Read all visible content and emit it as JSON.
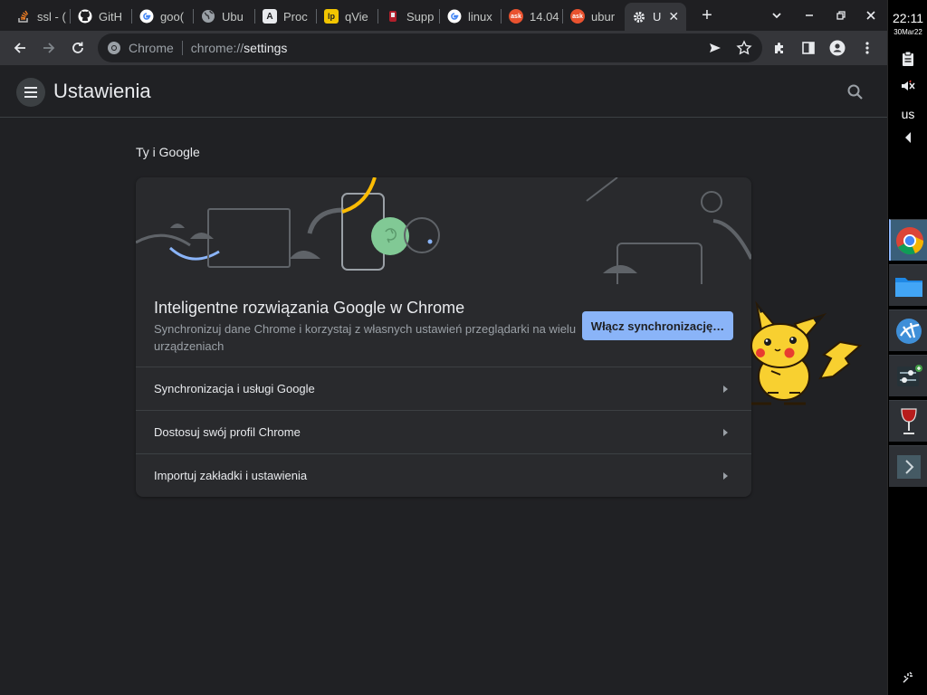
{
  "tabs": [
    {
      "title": "ssl - (",
      "icon": "stackoverflow-icon",
      "color": "#f48024"
    },
    {
      "title": "GitH",
      "icon": "github-icon",
      "color": "#ffffff"
    },
    {
      "title": "goo(",
      "icon": "google-icon",
      "color": "#ffffff"
    },
    {
      "title": "Ubu",
      "icon": "globe-icon",
      "color": "#c4c7c5"
    },
    {
      "title": "Proc",
      "icon": "letter-a-icon",
      "color": "#e8eaed"
    },
    {
      "title": "qVie",
      "icon": "lp-icon",
      "color": "#f2c500"
    },
    {
      "title": "Supp",
      "icon": "document-icon",
      "color": "#b11f2b"
    },
    {
      "title": "linux",
      "icon": "google-icon",
      "color": "#ffffff"
    },
    {
      "title": "14.04",
      "icon": "askubuntu-icon",
      "color": "#e9522f"
    },
    {
      "title": "ubur",
      "icon": "askubuntu-icon",
      "color": "#e9522f"
    },
    {
      "title": "U",
      "icon": "settings-gear-icon",
      "color": "#e8eaed",
      "active": true
    }
  ],
  "omnibox": {
    "origin_label": "Chrome",
    "scheme": "chrome://",
    "host": "settings"
  },
  "header": {
    "title": "Ustawienia"
  },
  "section": {
    "title": "Ty i Google"
  },
  "promo": {
    "title": "Inteligentne rozwiązania Google w Chrome",
    "description": "Synchronizuj dane Chrome i korzystaj z własnych ustawień przeglądarki na wielu urządzeniach",
    "sync_button": "Włącz synchronizację…"
  },
  "rows": [
    {
      "label": "Synchronizacja i usługi Google"
    },
    {
      "label": "Dostosuj swój profil Chrome"
    },
    {
      "label": "Importuj zakładki i ustawienia"
    }
  ],
  "panel": {
    "time": "22:11",
    "date": "30Mar22",
    "keyboard_layout": "us"
  },
  "colors": {
    "accent": "#8ab4f8",
    "background": "#202124",
    "card": "#292a2d"
  }
}
